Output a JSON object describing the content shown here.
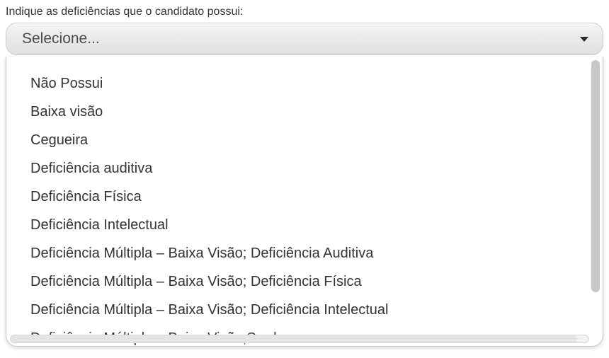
{
  "form": {
    "label": "Indique as deficiências que o candidato possui:",
    "placeholder": "Selecione..."
  },
  "options": [
    "Não Possui",
    "Baixa visão",
    "Cegueira",
    "Deficiência auditiva",
    "Deficiência Física",
    "Deficiência Intelectual",
    "Deficiência Múltipla – Baixa Visão; Deficiência Auditiva",
    "Deficiência Múltipla – Baixa Visão; Deficiência Física",
    "Deficiência Múltipla – Baixa Visão; Deficiência Intelectual",
    "Deficiência Múltipla – Baixa Visão;Surdez"
  ]
}
